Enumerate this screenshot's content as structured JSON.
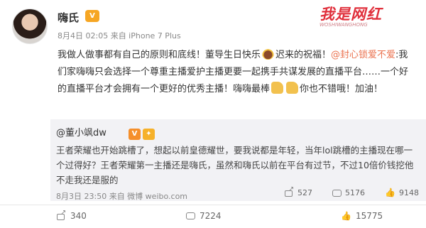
{
  "post": {
    "author": "嗨氏",
    "vip_badge": "V",
    "meta": "8月4日 02:05 来自 iPhone 7 Plus",
    "text_line1": "我做人做事都有自己的原则和底线！董导生日快乐",
    "text_line1b": "迟来的祝福！",
    "mention": "@封心锁爱不爱",
    "text_line2": ":我们家嗨嗨只会选择一个尊重主播爱护主播更要一起携手共谋发展的直播平台……一个好的直播平台才会拥有一个更好的优秀主播！嗨嗨最棒",
    "text_line3": "你也不错哦！加油！",
    "emoji": [
      "cake-emoji",
      "thumbs-up-emoji",
      "thumbs-up-emoji"
    ]
  },
  "watermark": {
    "text": "我是网红",
    "sub": "WOSHIWANGHONG"
  },
  "repost": {
    "user": "@董小飒dw",
    "text": "王者荣耀也开始跳槽了，想起以前皇德耀世，要我说都是年轻，当年lol跳槽的主播现在哪一个过得好？王者荣耀第一主播还是嗨氏，虽然和嗨氏以前在平台有过节，不过10倍价钱挖他不走我还是服的",
    "meta": "8月3日 23:50 来自 微博 weibo.com",
    "shares": "527",
    "comments": "5176",
    "likes": "9148"
  },
  "footer": {
    "shares": "340",
    "comments": "7224",
    "likes": "15775"
  },
  "colors": {
    "link": "#eb7350",
    "watermark": "#e0303c",
    "repost_bg": "#f2f2f5"
  }
}
